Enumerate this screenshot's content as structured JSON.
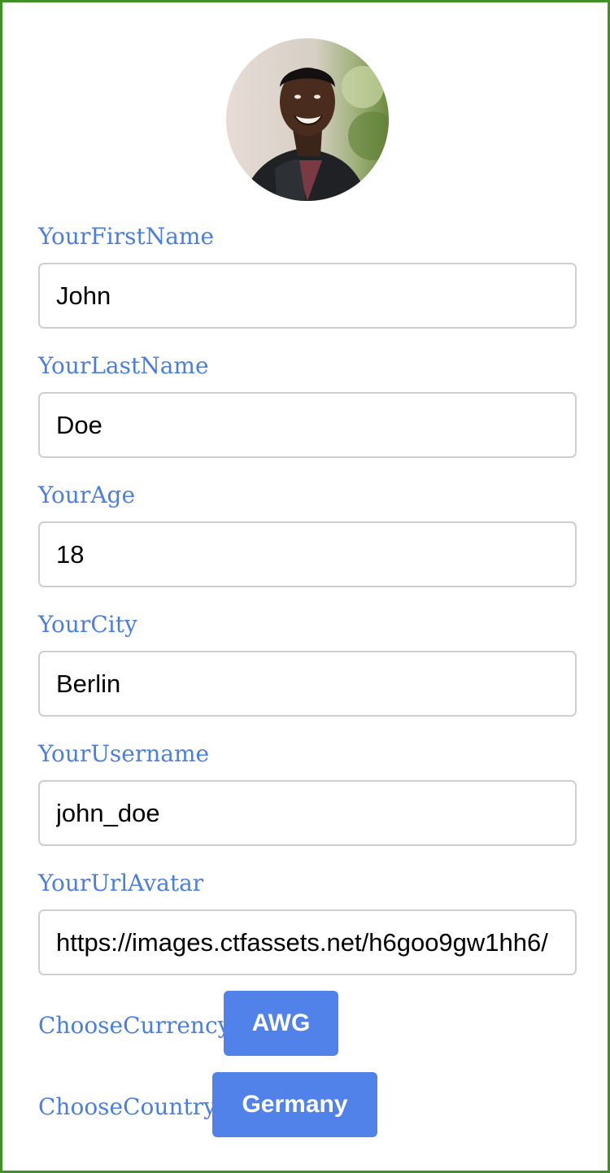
{
  "colors": {
    "frame_border": "#3f9126",
    "label_text": "#4a7fe0",
    "button_bg": "#5182ea",
    "button_text": "#ffffff",
    "input_border": "#cfcfcf"
  },
  "avatar": {
    "icon": "user-avatar-photo"
  },
  "fields": {
    "first_name": {
      "label": "YourFirstName",
      "value": "John"
    },
    "last_name": {
      "label": "YourLastName",
      "value": "Doe"
    },
    "age": {
      "label": "YourAge",
      "value": "18"
    },
    "city": {
      "label": "YourCity",
      "value": "Berlin"
    },
    "username": {
      "label": "YourUsername",
      "value": "john_doe"
    },
    "url_avatar": {
      "label": "YourUrlAvatar",
      "value": "https://images.ctfassets.net/h6goo9gw1hh6/"
    }
  },
  "currency": {
    "label": "ChooseCurrency",
    "selected": "AWG"
  },
  "country": {
    "label": "ChooseCountry",
    "selected": "Germany"
  }
}
